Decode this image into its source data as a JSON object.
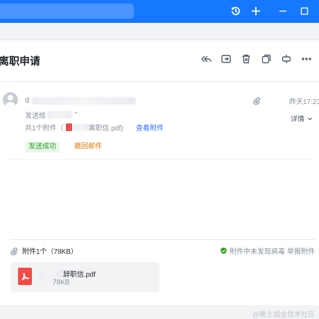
{
  "window": {
    "icons": [
      "history-icon",
      "plus-icon",
      "minimize-icon",
      "maximize-icon"
    ]
  },
  "email": {
    "subject": "离职申请",
    "sender_prefix": "d",
    "time": "昨天17:23",
    "to_label": "发送给",
    "details_label": "详情",
    "attachment_summary_prefix": "共1个附件（",
    "attachment_summary_file": "离职信.pdf)",
    "view_attachments": "查看附件",
    "status_badge": "发送成功",
    "recall_label": "撤回邮件"
  },
  "toolbar": {
    "icons": [
      "reply-all-icon",
      "forward-icon",
      "delete-icon",
      "copy-icon",
      "move-icon",
      "more-icon"
    ]
  },
  "attachments": {
    "header": "附件1个（78KB）",
    "safe_text": "附件中未发现病毒",
    "report_label": "举报附件",
    "file": {
      "name": "辞职信.pdf",
      "size": "78KB"
    }
  },
  "watermark": "@稀土掘金技术社区",
  "colors": {
    "accent": "#1677ff",
    "link": "#3370ff",
    "success": "#2ea121",
    "warning": "#de7802",
    "pdf_red": "#f54a45"
  }
}
